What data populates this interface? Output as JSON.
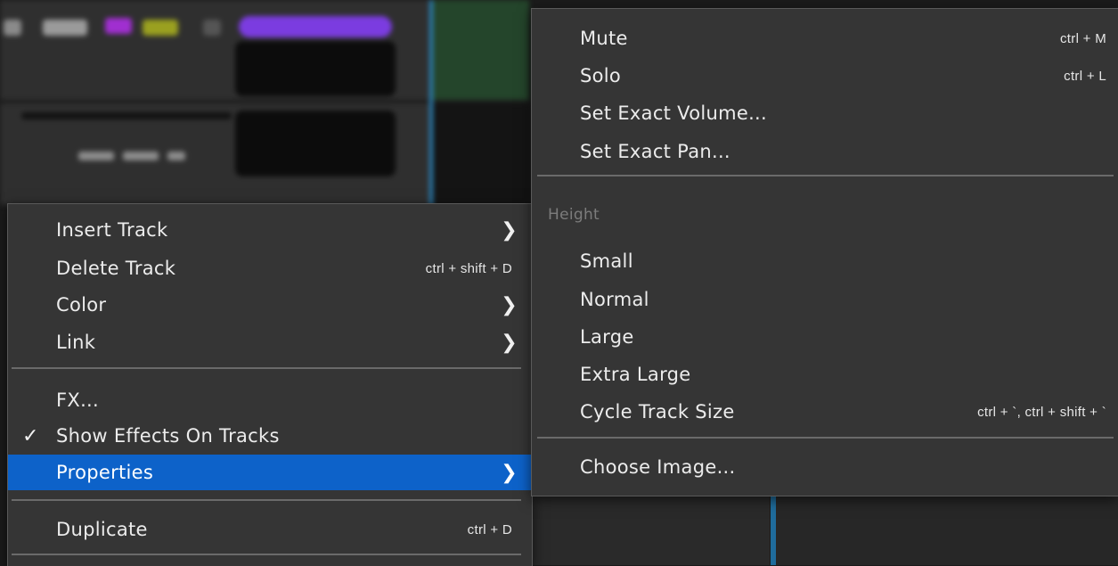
{
  "colors": {
    "menu_bg": "#353535",
    "highlight": "#0d62c9",
    "separator": "#6a6a6a",
    "section_title": "#7c7c7c",
    "accent_line": "#2a86c0"
  },
  "track_context_menu": {
    "items": [
      {
        "label": "Insert Track",
        "has_submenu": true
      },
      {
        "label": "Delete Track",
        "shortcut": "ctrl + shift + D"
      },
      {
        "label": "Color",
        "has_submenu": true
      },
      {
        "label": "Link",
        "has_submenu": true
      },
      {
        "label": "FX..."
      },
      {
        "label": "Show Effects On Tracks",
        "checked": true,
        "check_glyph": "✓"
      },
      {
        "label": "Properties",
        "has_submenu": true,
        "selected": true
      },
      {
        "label": "Duplicate",
        "shortcut": "ctrl + D"
      }
    ]
  },
  "properties_submenu": {
    "items": [
      {
        "label": "Mute",
        "shortcut": "ctrl + M"
      },
      {
        "label": "Solo",
        "shortcut": "ctrl + L"
      },
      {
        "label": "Set Exact Volume..."
      },
      {
        "label": "Set Exact Pan..."
      }
    ],
    "height_section": {
      "title": "Height",
      "items": [
        {
          "label": "Small"
        },
        {
          "label": "Normal"
        },
        {
          "label": "Large"
        },
        {
          "label": "Extra Large"
        },
        {
          "label": "Cycle Track Size",
          "shortcut": "ctrl + `, ctrl + shift + `"
        }
      ]
    },
    "image_item": {
      "label": "Choose Image..."
    }
  },
  "icons": {
    "submenu_arrow": "chevron-right-icon",
    "checkmark": "checkmark-icon"
  }
}
